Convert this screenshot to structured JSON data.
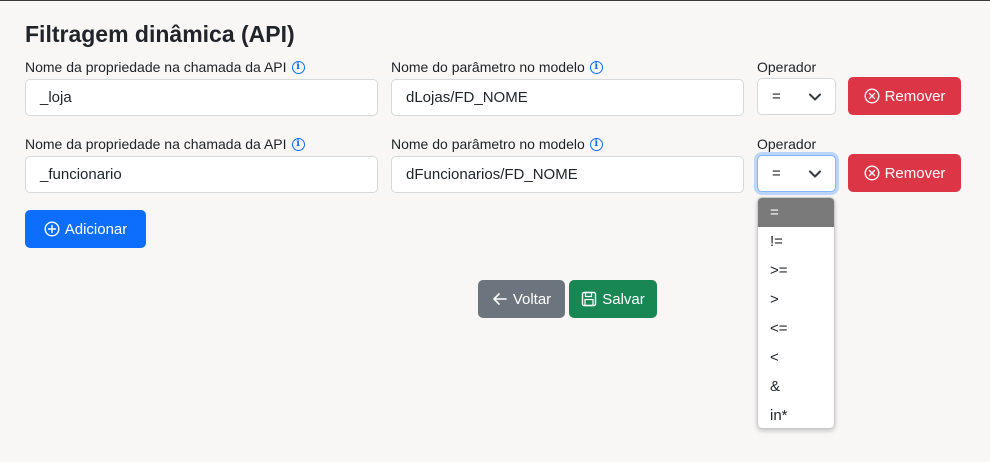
{
  "title": "Filtragem dinâmica (API)",
  "labels": {
    "prop": "Nome da propriedade na chamada da API",
    "param": "Nome do parâmetro no modelo",
    "operator": "Operador"
  },
  "rows": [
    {
      "prop_value": "_loja",
      "param_value": "dLojas/FD_NOME",
      "operator": "=",
      "remove_label": "Remover"
    },
    {
      "prop_value": "_funcionario",
      "param_value": "dFuncionarios/FD_NOME",
      "operator": "=",
      "remove_label": "Remover"
    }
  ],
  "add_label": "Adicionar",
  "back_label": "Voltar",
  "save_label": "Salvar",
  "operator_options": [
    "=",
    "!=",
    ">=",
    ">",
    "<=",
    "<",
    "&",
    "in*"
  ],
  "colors": {
    "danger": "#dc3545",
    "primary": "#0d6efd",
    "secondary": "#6c757d",
    "success": "#198754"
  }
}
